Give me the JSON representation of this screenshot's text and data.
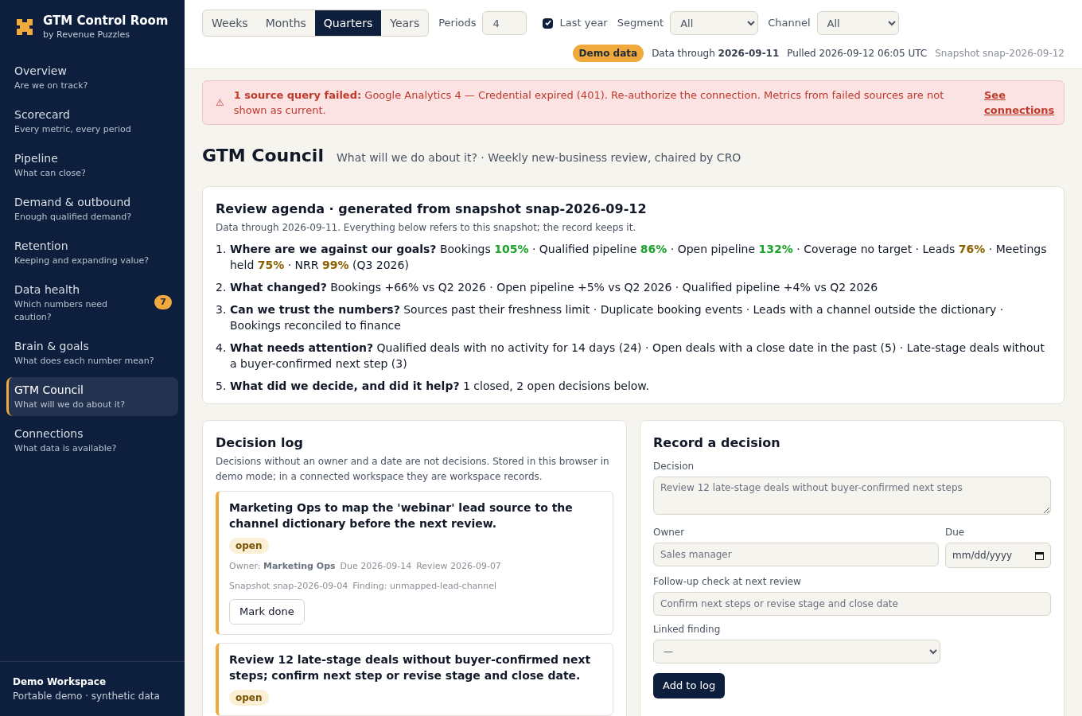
{
  "brand": {
    "title": "GTM Control Room",
    "subtitle": "by Revenue Puzzles"
  },
  "nav": [
    {
      "label": "Overview",
      "hint": "Are we on track?",
      "selected": false
    },
    {
      "label": "Scorecard",
      "hint": "Every metric, every period",
      "selected": false
    },
    {
      "label": "Pipeline",
      "hint": "What can close?",
      "selected": false
    },
    {
      "label": "Demand & outbound",
      "hint": "Enough qualified demand?",
      "selected": false
    },
    {
      "label": "Retention",
      "hint": "Keeping and expanding value?",
      "selected": false
    },
    {
      "label": "Data health",
      "hint": "Which numbers need caution?",
      "badge": "7",
      "selected": false
    },
    {
      "label": "Brain & goals",
      "hint": "What does each number mean?",
      "selected": false
    },
    {
      "label": "GTM Council",
      "hint": "What will we do about it?",
      "selected": true
    },
    {
      "label": "Connections",
      "hint": "What data is available?",
      "selected": false
    }
  ],
  "workspace": {
    "name": "Demo Workspace",
    "note": "Portable demo · synthetic data"
  },
  "toolbar": {
    "granularity": [
      {
        "label": "Weeks",
        "selected": false
      },
      {
        "label": "Months",
        "selected": false
      },
      {
        "label": "Quarters",
        "selected": true
      },
      {
        "label": "Years",
        "selected": false
      }
    ],
    "periods_label": "Periods",
    "periods_value": "4",
    "last_year": {
      "label": "Last year",
      "checked": true
    },
    "segment": {
      "label": "Segment",
      "value": "All"
    },
    "channel": {
      "label": "Channel",
      "value": "All"
    }
  },
  "status": {
    "badge": "Demo data",
    "data_through": "Data through **2026-09-11**",
    "pulled": "Pulled 2026-09-12 06:05 UTC",
    "snapshot": "Snapshot snap-2026-09-12"
  },
  "alert": {
    "icon": "⚠",
    "text": "**1 source query failed:** Google Analytics 4 — Credential expired (401). Re-authorize the connection. Metrics from failed sources are not shown as current.",
    "link": "See connections"
  },
  "page": {
    "title": "GTM Council",
    "subtitle": "What will we do about it? · Weekly new-business review, chaired by CRO"
  },
  "agenda": {
    "title": "Review agenda · generated from snapshot snap-2026-09-12",
    "note": "Data through 2026-09-11. Everything below refers to this snapshot; the record keeps it.",
    "items": [
      {
        "number": "1.",
        "lead": "Where are we against our goals?",
        "parts": [
          {
            "text": " Bookings "
          },
          {
            "text": "105%",
            "color": "#1aa32a"
          },
          {
            "text": " · Qualified pipeline "
          },
          {
            "text": "86%",
            "color": "#1aa32a"
          },
          {
            "text": " · Open pipeline "
          },
          {
            "text": "132%",
            "color": "#1aa32a"
          },
          {
            "text": " · Coverage no target · Leads "
          },
          {
            "text": "76%",
            "color": "#8a6100"
          },
          {
            "text": " · Meetings held "
          },
          {
            "text": "75%",
            "color": "#8a6100"
          },
          {
            "text": " · NRR "
          },
          {
            "text": "99%",
            "color": "#8a6100"
          },
          {
            "text": " (Q3 2026)"
          }
        ]
      },
      {
        "number": "2.",
        "lead": "What changed?",
        "parts": [
          {
            "text": " Bookings +66% vs Q2 2026 · Open pipeline +5% vs Q2 2026 · Qualified pipeline +4% vs Q2 2026"
          }
        ]
      },
      {
        "number": "3.",
        "lead": "Can we trust the numbers?",
        "parts": [
          {
            "text": " Sources past their freshness limit · Duplicate booking events · Leads with a channel outside the dictionary · Bookings reconciled to finance"
          }
        ]
      },
      {
        "number": "4.",
        "lead": "What needs attention?",
        "parts": [
          {
            "text": " Qualified deals with no activity for 14 days (24) · Open deals with a close date in the past (5) · Late-stage deals without a buyer-confirmed next step (3)"
          }
        ]
      },
      {
        "number": "5.",
        "lead": "What did we decide, and did it help?",
        "parts": [
          {
            "text": " 1 closed, 2 open decisions below."
          }
        ]
      }
    ]
  },
  "log": {
    "title": "Decision log",
    "note": "Decisions without an owner and a date are not decisions. Stored in this browser in demo mode; in a connected workspace they are workspace records.",
    "decisions": [
      {
        "title": "Marketing Ops to map the 'webinar' lead source to the channel dictionary before the next review.",
        "status": "open",
        "meta": [
          "Owner: **Marketing Ops**",
          "Due 2026-09-14",
          "Review 2026-09-07"
        ],
        "meta2": [
          "Snapshot snap-2026-09-04",
          "Finding: unmapped-lead-channel"
        ],
        "action": "Mark done"
      },
      {
        "title": "Review 12 late-stage deals without buyer-confirmed next steps; confirm next step or revise stage and close date.",
        "status": "open"
      }
    ]
  },
  "form": {
    "title": "Record a decision",
    "decision_label": "Decision",
    "decision_placeholder": "Review 12 late-stage deals without buyer-confirmed next steps",
    "owner_label": "Owner",
    "owner_placeholder": "Sales manager",
    "due_label": "Due",
    "due_value": "mm/dd/yyyy",
    "followup_label": "Follow-up check at next review",
    "followup_placeholder": "Confirm next steps or revise stage and close date",
    "linked_label": "Linked finding",
    "linked_value": "—",
    "submit": "Add to log"
  }
}
